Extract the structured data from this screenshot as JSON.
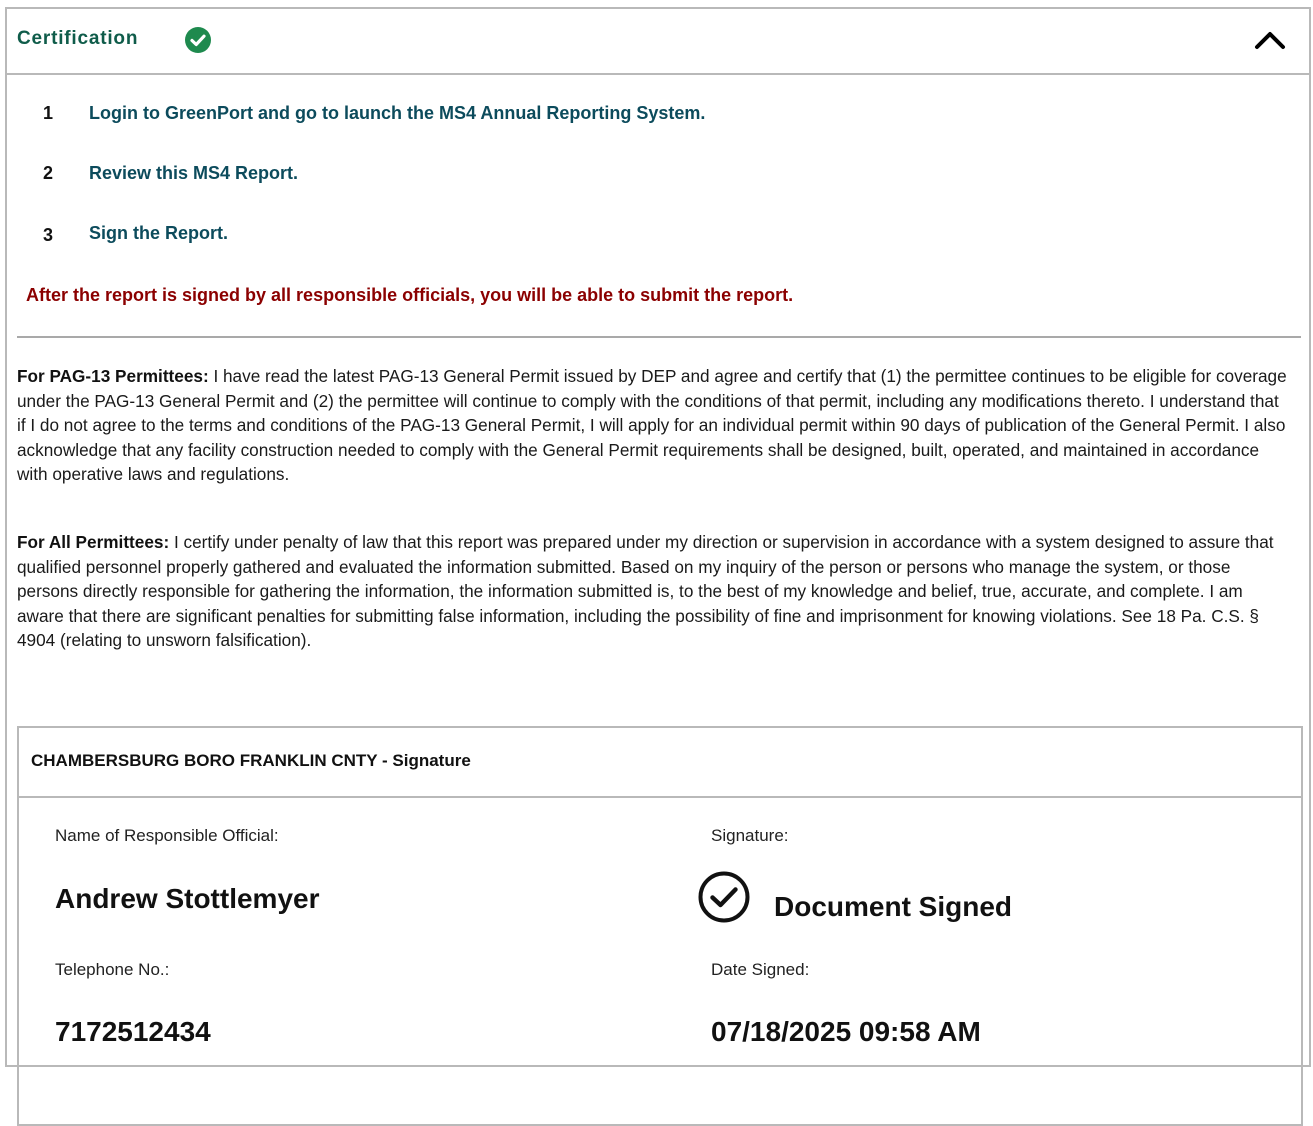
{
  "section": {
    "title": "Certification",
    "status_icon": "check-circle-icon",
    "collapse_icon": "chevron-up-icon",
    "accent_color": "#0f5c4a",
    "success_color": "#1e8a4e"
  },
  "steps": [
    {
      "number": "1",
      "text": "Login to GreenPort and go to launch the MS4 Annual Reporting System."
    },
    {
      "number": "2",
      "text": "Review this MS4 Report."
    },
    {
      "number": "3",
      "text": "Sign the Report."
    }
  ],
  "warning": {
    "text": "After the report is signed by all responsible officials, you will be able to submit the report.",
    "color": "#8b0000"
  },
  "certifications": [
    {
      "heading": "For PAG-13 Permittees:",
      "body": "I have read the latest PAG-13 General Permit issued by DEP and agree and certify that (1) the permittee continues to be eligible for coverage under the PAG-13 General Permit and (2) the permittee will continue to comply with the conditions of that permit, including any modifications thereto. I understand that if I do not agree to the terms and conditions of the PAG-13 General Permit, I will apply for an individual permit within 90 days of publication of the General Permit. I also acknowledge that any facility construction needed to comply with the General Permit requirements shall be designed, built, operated, and maintained in accordance with operative laws and regulations."
    },
    {
      "heading": "For All Permittees:",
      "body": "I certify under penalty of law that this report was prepared under my direction or supervision in accordance with a system designed to assure that qualified personnel properly gathered and evaluated the information submitted. Based on my inquiry of the person or persons who manage the system, or those persons directly responsible for gathering the information, the information submitted is, to the best of my knowledge and belief, true, accurate, and complete. I am aware that there are significant penalties for submitting false information, including the possibility of fine and imprisonment for knowing violations. See 18 Pa. C.S. § 4904 (relating to unsworn falsification)."
    }
  ],
  "signature": {
    "header": "CHAMBERSBURG BORO FRANKLIN CNTY - Signature",
    "official_label": "Name of Responsible Official:",
    "official_name": "Andrew Stottlemyer",
    "signature_label": "Signature:",
    "signature_status": "Document Signed",
    "signature_icon": "check-circle-outline-icon",
    "phone_label": "Telephone No.:",
    "phone": "7172512434",
    "date_label": "Date Signed:",
    "date": "07/18/2025 09:58 AM"
  }
}
